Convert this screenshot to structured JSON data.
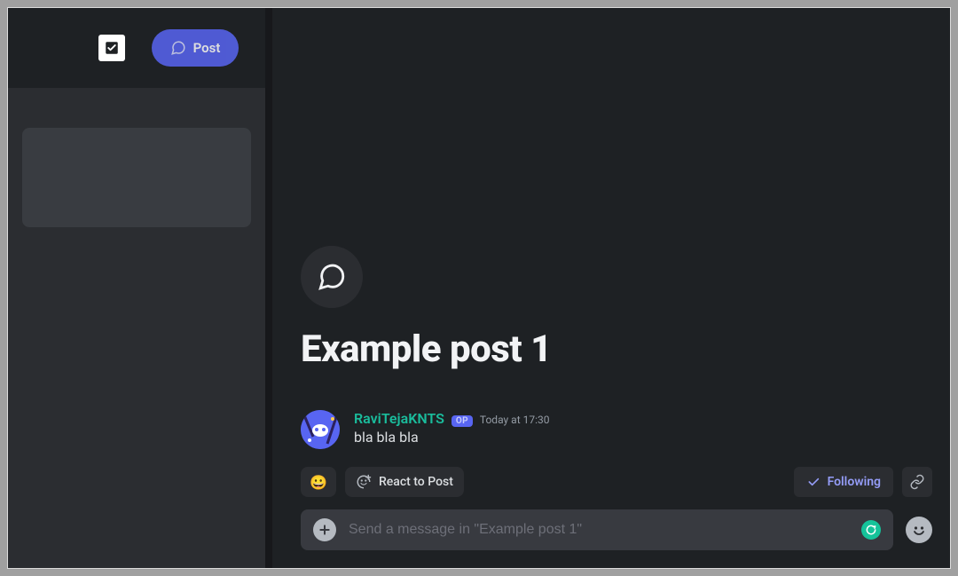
{
  "sidebar": {
    "post_button_label": "Post"
  },
  "thread": {
    "title": "Example post 1",
    "author": "RaviTejaKNTS",
    "op_badge": "OP",
    "timestamp": "Today at 17:30",
    "body": "bla bla bla"
  },
  "actions": {
    "react_emoji": "😀",
    "react_label": "React to Post",
    "following_label": "Following"
  },
  "composer": {
    "placeholder": "Send a message in \"Example post 1\"",
    "emoji_picker": "😀"
  }
}
